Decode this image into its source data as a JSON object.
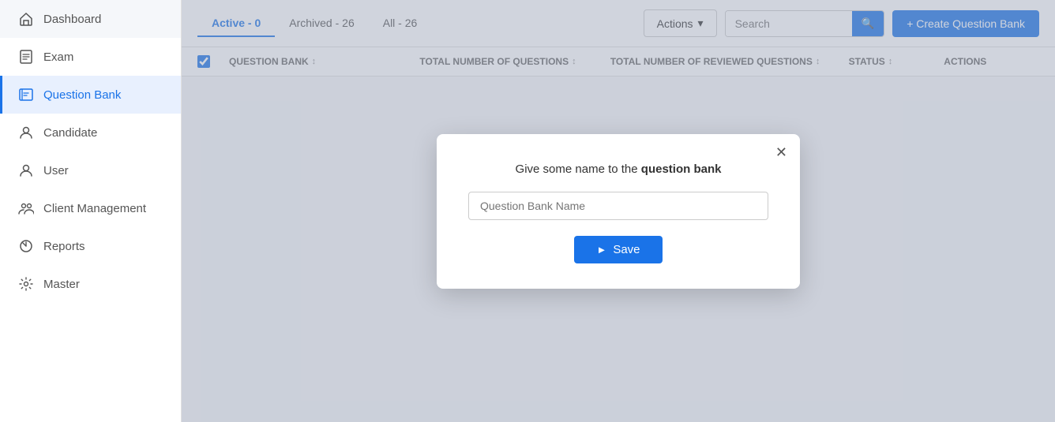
{
  "sidebar": {
    "items": [
      {
        "label": "Dashboard",
        "icon": "home-icon",
        "active": false
      },
      {
        "label": "Exam",
        "icon": "exam-icon",
        "active": false
      },
      {
        "label": "Question Bank",
        "icon": "question-bank-icon",
        "active": true
      },
      {
        "label": "Candidate",
        "icon": "candidate-icon",
        "active": false
      },
      {
        "label": "User",
        "icon": "user-icon",
        "active": false
      },
      {
        "label": "Client Management",
        "icon": "client-icon",
        "active": false
      },
      {
        "label": "Reports",
        "icon": "reports-icon",
        "active": false
      },
      {
        "label": "Master",
        "icon": "master-icon",
        "active": false
      }
    ]
  },
  "topbar": {
    "tabs": [
      {
        "label": "Active - 0",
        "active": true
      },
      {
        "label": "Archived - 26",
        "active": false
      },
      {
        "label": "All - 26",
        "active": false
      }
    ],
    "actions_label": "Actions",
    "search_placeholder": "Search",
    "create_label": "+ Create Question Bank"
  },
  "table": {
    "columns": [
      {
        "label": "QUESTION BANK"
      },
      {
        "label": "TOTAL NUMBER OF QUESTIONS"
      },
      {
        "label": "TOTAL NUMBER OF REVIEWED QUESTIONS"
      },
      {
        "label": "STATUS"
      },
      {
        "label": "Actions"
      }
    ]
  },
  "modal": {
    "title_text": "Give some name to the ",
    "title_bold": "question bank",
    "input_placeholder": "Question Bank Name",
    "save_label": "Save",
    "close_aria": "close"
  }
}
